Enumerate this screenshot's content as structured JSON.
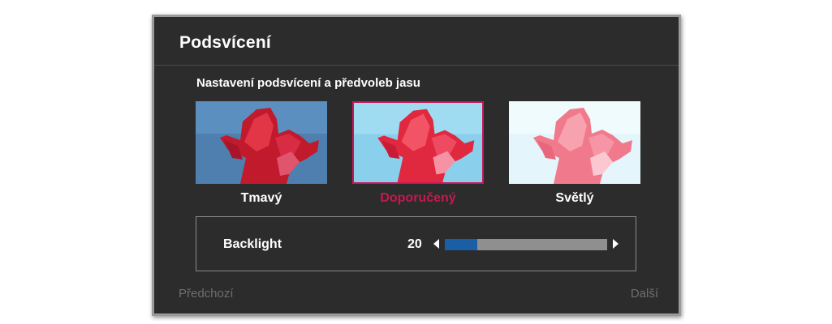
{
  "dialog": {
    "title": "Podsvícení",
    "subtitle": "Nastavení podsvícení a předvoleb jasu"
  },
  "presets": [
    {
      "label": "Tmavý",
      "selected": false,
      "image": "tulip-photo-dark"
    },
    {
      "label": "Doporučený",
      "selected": true,
      "image": "tulip-photo-recommended"
    },
    {
      "label": "Světlý",
      "selected": false,
      "image": "tulip-photo-bright"
    }
  ],
  "setting": {
    "label": "Backlight",
    "value": "20",
    "min": 0,
    "max": 100
  },
  "nav": {
    "prev": "Předchozí",
    "next": "Další"
  },
  "colors": {
    "accent": "#c8174e",
    "slider_fill": "#1a5ea6",
    "background": "#2c2c2c"
  }
}
